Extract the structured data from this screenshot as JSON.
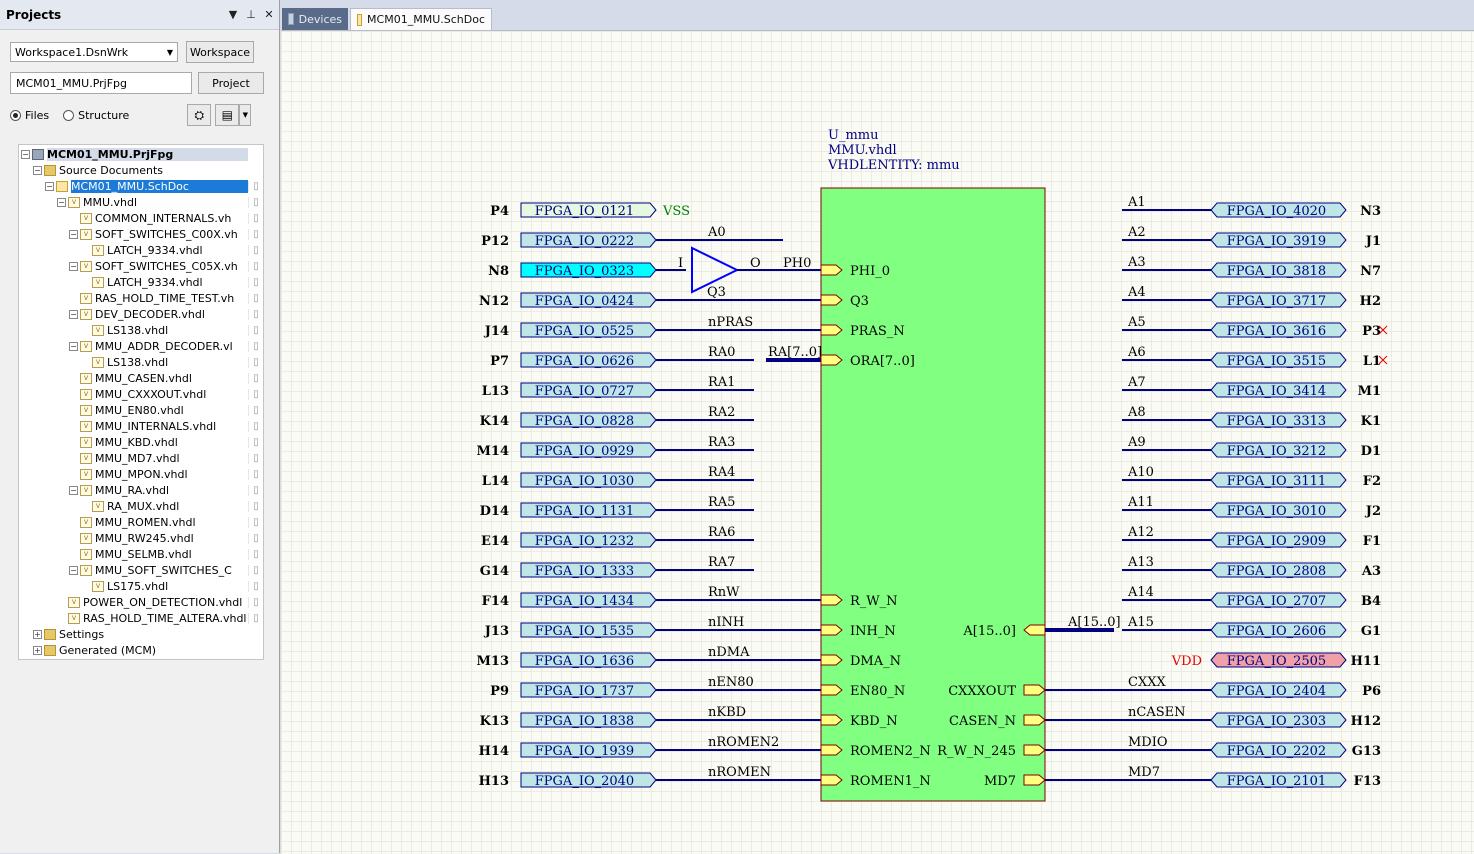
{
  "projects_panel": {
    "title": "Projects",
    "workspace_combo": "Workspace1.DsnWrk",
    "workspace_button": "Workspace",
    "project_field": "MCM01_MMU.PrjFpg",
    "project_button": "Project",
    "view_files": "Files",
    "view_structure": "Structure",
    "view_selected": "Files"
  },
  "tree": [
    {
      "label": "MCM01_MMU.PrjFpg",
      "depth": 0,
      "exp": "-",
      "icon": "proj",
      "state": "root",
      "doc": false
    },
    {
      "label": "Source Documents",
      "depth": 1,
      "exp": "-",
      "icon": "folder",
      "state": "",
      "doc": false
    },
    {
      "label": "MCM01_MMU.SchDoc",
      "depth": 2,
      "exp": "-",
      "icon": "sch",
      "state": "sel",
      "doc": true
    },
    {
      "label": "MMU.vhdl",
      "depth": 3,
      "exp": "-",
      "icon": "file",
      "state": "",
      "doc": true
    },
    {
      "label": "COMMON_INTERNALS.vh",
      "depth": 4,
      "exp": "",
      "icon": "file",
      "state": "",
      "doc": true
    },
    {
      "label": "SOFT_SWITCHES_C00X.vh",
      "depth": 4,
      "exp": "-",
      "icon": "file",
      "state": "",
      "doc": true
    },
    {
      "label": "LATCH_9334.vhdl",
      "depth": 5,
      "exp": "",
      "icon": "file",
      "state": "",
      "doc": true
    },
    {
      "label": "SOFT_SWITCHES_C05X.vh",
      "depth": 4,
      "exp": "-",
      "icon": "file",
      "state": "",
      "doc": true
    },
    {
      "label": "LATCH_9334.vhdl",
      "depth": 5,
      "exp": "",
      "icon": "file",
      "state": "",
      "doc": true
    },
    {
      "label": "RAS_HOLD_TIME_TEST.vh",
      "depth": 4,
      "exp": "",
      "icon": "file",
      "state": "",
      "doc": true
    },
    {
      "label": "DEV_DECODER.vhdl",
      "depth": 4,
      "exp": "-",
      "icon": "file",
      "state": "",
      "doc": true
    },
    {
      "label": "LS138.vhdl",
      "depth": 5,
      "exp": "",
      "icon": "file",
      "state": "",
      "doc": true
    },
    {
      "label": "MMU_ADDR_DECODER.vl",
      "depth": 4,
      "exp": "-",
      "icon": "file",
      "state": "",
      "doc": true
    },
    {
      "label": "LS138.vhdl",
      "depth": 5,
      "exp": "",
      "icon": "file",
      "state": "",
      "doc": true
    },
    {
      "label": "MMU_CASEN.vhdl",
      "depth": 4,
      "exp": "",
      "icon": "file",
      "state": "",
      "doc": true
    },
    {
      "label": "MMU_CXXXOUT.vhdl",
      "depth": 4,
      "exp": "",
      "icon": "file",
      "state": "",
      "doc": true
    },
    {
      "label": "MMU_EN80.vhdl",
      "depth": 4,
      "exp": "",
      "icon": "file",
      "state": "",
      "doc": true
    },
    {
      "label": "MMU_INTERNALS.vhdl",
      "depth": 4,
      "exp": "",
      "icon": "file",
      "state": "",
      "doc": true
    },
    {
      "label": "MMU_KBD.vhdl",
      "depth": 4,
      "exp": "",
      "icon": "file",
      "state": "",
      "doc": true
    },
    {
      "label": "MMU_MD7.vhdl",
      "depth": 4,
      "exp": "",
      "icon": "file",
      "state": "",
      "doc": true
    },
    {
      "label": "MMU_MPON.vhdl",
      "depth": 4,
      "exp": "",
      "icon": "file",
      "state": "",
      "doc": true
    },
    {
      "label": "MMU_RA.vhdl",
      "depth": 4,
      "exp": "-",
      "icon": "file",
      "state": "",
      "doc": true
    },
    {
      "label": "RA_MUX.vhdl",
      "depth": 5,
      "exp": "",
      "icon": "file",
      "state": "",
      "doc": true
    },
    {
      "label": "MMU_ROMEN.vhdl",
      "depth": 4,
      "exp": "",
      "icon": "file",
      "state": "",
      "doc": true
    },
    {
      "label": "MMU_RW245.vhdl",
      "depth": 4,
      "exp": "",
      "icon": "file",
      "state": "",
      "doc": true
    },
    {
      "label": "MMU_SELMB.vhdl",
      "depth": 4,
      "exp": "",
      "icon": "file",
      "state": "",
      "doc": true
    },
    {
      "label": "MMU_SOFT_SWITCHES_C",
      "depth": 4,
      "exp": "-",
      "icon": "file",
      "state": "",
      "doc": true
    },
    {
      "label": "LS175.vhdl",
      "depth": 5,
      "exp": "",
      "icon": "file",
      "state": "",
      "doc": true
    },
    {
      "label": "POWER_ON_DETECTION.vhdl",
      "depth": 3,
      "exp": "",
      "icon": "file",
      "state": "",
      "doc": true
    },
    {
      "label": "RAS_HOLD_TIME_ALTERA.vhdl",
      "depth": 3,
      "exp": "",
      "icon": "file",
      "state": "",
      "doc": true
    },
    {
      "label": "Settings",
      "depth": 1,
      "exp": "+",
      "icon": "folder",
      "state": "",
      "doc": false
    },
    {
      "label": "Generated (MCM)",
      "depth": 1,
      "exp": "+",
      "icon": "folder",
      "state": "",
      "doc": false
    }
  ],
  "tabs": [
    {
      "label": "Devices",
      "active": false
    },
    {
      "label": "MCM01_MMU.SchDoc",
      "active": true
    }
  ],
  "colors": {
    "wire": "#000080",
    "block_fill": "#80ff80",
    "port_fill": "#bfe6e6",
    "vss_port": "#e6f8e0",
    "highlight_port": "#00ffff",
    "vdd_port": "#f0a0a8",
    "vdd_text": "#e00000",
    "vss_text": "#008000"
  },
  "schematic": {
    "component": {
      "designator": "U_mmu",
      "file": "MMU.vhdl",
      "entity": "VHDLENTITY: mmu"
    },
    "buffer": {
      "in": "I",
      "out": "O",
      "designator": "Q3",
      "net_out": "PH0"
    },
    "bus_label_left": "RA[7..0]",
    "bus_label_right": "A[15..0]",
    "left_rows": [
      {
        "pin": "P4",
        "port": "FPGA_IO_0121",
        "net": "VSS",
        "target": "",
        "style": "vss"
      },
      {
        "pin": "P12",
        "port": "FPGA_IO_0222",
        "net": "A0",
        "target": "",
        "style": ""
      },
      {
        "pin": "N8",
        "port": "FPGA_IO_0323",
        "net": "",
        "target": "PHI_0",
        "style": "highlight"
      },
      {
        "pin": "N12",
        "port": "FPGA_IO_0424",
        "net": "",
        "target": "Q3",
        "style": ""
      },
      {
        "pin": "J14",
        "port": "FPGA_IO_0525",
        "net": "nPRAS",
        "target": "PRAS_N",
        "style": ""
      },
      {
        "pin": "P7",
        "port": "FPGA_IO_0626",
        "net": "RA0",
        "target": "",
        "style": ""
      },
      {
        "pin": "L13",
        "port": "FPGA_IO_0727",
        "net": "RA1",
        "target": "",
        "style": ""
      },
      {
        "pin": "K14",
        "port": "FPGA_IO_0828",
        "net": "RA2",
        "target": "",
        "style": ""
      },
      {
        "pin": "M14",
        "port": "FPGA_IO_0929",
        "net": "RA3",
        "target": "",
        "style": ""
      },
      {
        "pin": "L14",
        "port": "FPGA_IO_1030",
        "net": "RA4",
        "target": "",
        "style": ""
      },
      {
        "pin": "D14",
        "port": "FPGA_IO_1131",
        "net": "RA5",
        "target": "",
        "style": ""
      },
      {
        "pin": "E14",
        "port": "FPGA_IO_1232",
        "net": "RA6",
        "target": "",
        "style": ""
      },
      {
        "pin": "G14",
        "port": "FPGA_IO_1333",
        "net": "RA7",
        "target": "",
        "style": ""
      },
      {
        "pin": "F14",
        "port": "FPGA_IO_1434",
        "net": "RnW",
        "target": "R_W_N",
        "style": ""
      },
      {
        "pin": "J13",
        "port": "FPGA_IO_1535",
        "net": "nINH",
        "target": "INH_N",
        "style": ""
      },
      {
        "pin": "M13",
        "port": "FPGA_IO_1636",
        "net": "nDMA",
        "target": "DMA_N",
        "style": ""
      },
      {
        "pin": "P9",
        "port": "FPGA_IO_1737",
        "net": "nEN80",
        "target": "EN80_N",
        "style": ""
      },
      {
        "pin": "K13",
        "port": "FPGA_IO_1838",
        "net": "nKBD",
        "target": "KBD_N",
        "style": ""
      },
      {
        "pin": "H14",
        "port": "FPGA_IO_1939",
        "net": "nROMEN2",
        "target": "ROMEN2_N",
        "style": ""
      },
      {
        "pin": "H13",
        "port": "FPGA_IO_2040",
        "net": "nROMEN",
        "target": "ROMEN1_N",
        "style": ""
      }
    ],
    "left_bus_port": "ORA[7..0]",
    "right_rows": [
      {
        "pin": "N3",
        "port": "FPGA_IO_4020",
        "net": "A1",
        "source": "",
        "style": ""
      },
      {
        "pin": "J1",
        "port": "FPGA_IO_3919",
        "net": "A2",
        "source": "",
        "style": ""
      },
      {
        "pin": "N7",
        "port": "FPGA_IO_3818",
        "net": "A3",
        "source": "",
        "style": ""
      },
      {
        "pin": "H2",
        "port": "FPGA_IO_3717",
        "net": "A4",
        "source": "",
        "style": ""
      },
      {
        "pin": "P3",
        "port": "FPGA_IO_3616",
        "net": "A5",
        "source": "",
        "style": "x"
      },
      {
        "pin": "L1",
        "port": "FPGA_IO_3515",
        "net": "A6",
        "source": "",
        "style": "x"
      },
      {
        "pin": "M1",
        "port": "FPGA_IO_3414",
        "net": "A7",
        "source": "",
        "style": ""
      },
      {
        "pin": "K1",
        "port": "FPGA_IO_3313",
        "net": "A8",
        "source": "",
        "style": ""
      },
      {
        "pin": "D1",
        "port": "FPGA_IO_3212",
        "net": "A9",
        "source": "",
        "style": ""
      },
      {
        "pin": "F2",
        "port": "FPGA_IO_3111",
        "net": "A10",
        "source": "",
        "style": ""
      },
      {
        "pin": "J2",
        "port": "FPGA_IO_3010",
        "net": "A11",
        "source": "",
        "style": ""
      },
      {
        "pin": "F1",
        "port": "FPGA_IO_2909",
        "net": "A12",
        "source": "",
        "style": ""
      },
      {
        "pin": "A3",
        "port": "FPGA_IO_2808",
        "net": "A13",
        "source": "",
        "style": ""
      },
      {
        "pin": "B4",
        "port": "FPGA_IO_2707",
        "net": "A14",
        "source": "",
        "style": ""
      },
      {
        "pin": "G1",
        "port": "FPGA_IO_2606",
        "net": "A15",
        "source": "",
        "style": ""
      },
      {
        "pin": "H11",
        "port": "FPGA_IO_2505",
        "net": "VDD",
        "source": "",
        "style": "vdd"
      },
      {
        "pin": "P6",
        "port": "FPGA_IO_2404",
        "net": "CXXX",
        "source": "CXXXOUT",
        "style": ""
      },
      {
        "pin": "H12",
        "port": "FPGA_IO_2303",
        "net": "nCASEN",
        "source": "CASEN_N",
        "style": ""
      },
      {
        "pin": "G13",
        "port": "FPGA_IO_2202",
        "net": "MDIO",
        "source": "R_W_N_245",
        "style": ""
      },
      {
        "pin": "F13",
        "port": "FPGA_IO_2101",
        "net": "MD7",
        "source": "MD7",
        "style": ""
      }
    ],
    "right_bus_port": "A[15..0]"
  }
}
